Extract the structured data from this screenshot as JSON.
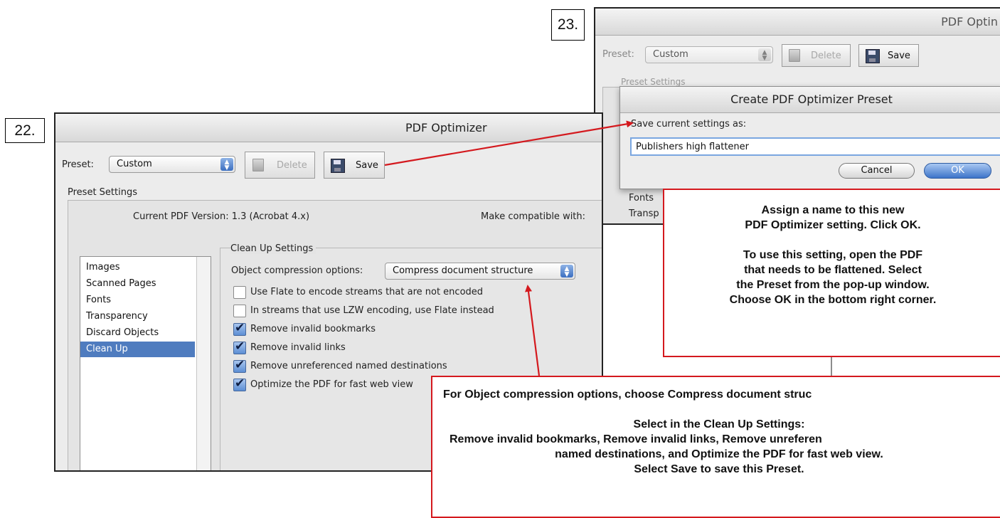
{
  "steps": {
    "left": "22.",
    "right": "23."
  },
  "optimizer_main": {
    "title": "PDF Optimizer",
    "preset_label": "Preset:",
    "preset_value": "Custom",
    "delete_label": "Delete",
    "save_label": "Save",
    "preset_settings_label": "Preset Settings",
    "current_version": "Current PDF Version: 1.3 (Acrobat 4.x)",
    "make_compatible": "Make compatible with:",
    "categories": [
      "Images",
      "Scanned Pages",
      "Fonts",
      "Transparency",
      "Discard Objects",
      "Clean Up"
    ],
    "selected_category": "Clean Up",
    "cleanup": {
      "heading": "Clean Up Settings",
      "compression_label": "Object compression options:",
      "compression_value": "Compress document structure",
      "options": [
        {
          "label": "Use Flate to encode streams that are not encoded",
          "checked": false
        },
        {
          "label": "In streams that use LZW encoding, use Flate instead",
          "checked": false
        },
        {
          "label": "Remove invalid bookmarks",
          "checked": true
        },
        {
          "label": "Remove invalid links",
          "checked": true
        },
        {
          "label": "Remove unreferenced named destinations",
          "checked": true
        },
        {
          "label": "Optimize the PDF for fast web view",
          "checked": true
        }
      ]
    }
  },
  "optimizer_back": {
    "title": "PDF Optin",
    "preset_label": "Preset:",
    "preset_value": "Custom",
    "delete_label": "Delete",
    "save_label": "Save",
    "preset_settings_label": "Preset Settings",
    "list_fonts": "Fonts",
    "list_transp": "Transp"
  },
  "create_dialog": {
    "title": "Create PDF Optimizer Preset",
    "prompt": "Save current settings as:",
    "name_value": "Publishers high flattener",
    "cancel_label": "Cancel",
    "ok_label": "OK"
  },
  "callout_top": {
    "lines": [
      "Assign a name to this new",
      "PDF Optimizer setting. Click OK.",
      "",
      "To use this setting, open the PDF",
      "that needs to be flattened. Select",
      "the Preset from the pop-up window.",
      "Choose OK in the bottom right corner."
    ]
  },
  "callout_bottom": {
    "lines": [
      "For Object compression options, choose Compress document struc",
      "",
      "Select in the Clean Up Settings:",
      "Remove invalid bookmarks, Remove invalid links, Remove unreferen",
      "named destinations, and Optimize the PDF for fast web view.",
      "Select Save to save this Preset."
    ]
  },
  "colors": {
    "callout_border": "#d4191e",
    "arrow": "#d4191e",
    "selection": "#4f7cbf"
  }
}
